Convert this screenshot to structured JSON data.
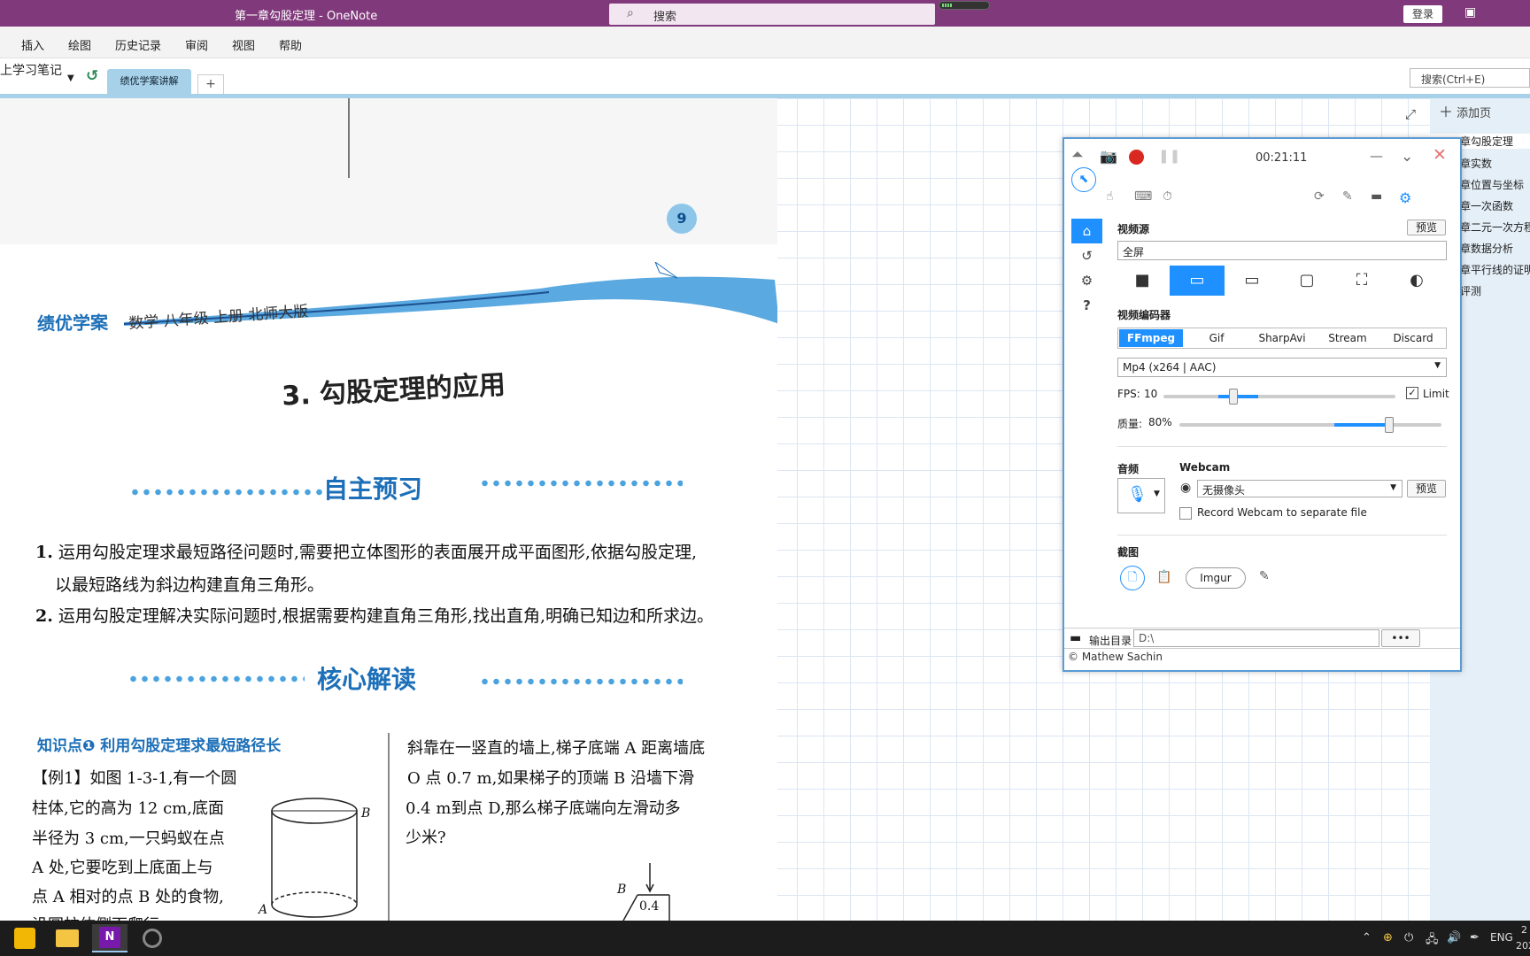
{
  "app": {
    "title": "第一章勾股定理  -  OneNote",
    "search_label": "搜索",
    "login_label": "登录"
  },
  "menu": [
    "插入",
    "绘图",
    "历史记录",
    "审阅",
    "视图",
    "帮助"
  ],
  "notebook": {
    "name": "上学习笔记",
    "section_tab": "绩优学案讲解",
    "add_tab": "+",
    "page_search_placeholder": "搜索(Ctrl+E)"
  },
  "pages": {
    "add_page_label": "添加页",
    "items": [
      "章勾股定理",
      "章实数",
      "章位置与坐标",
      "章一次函数",
      "章二元一次方程",
      "章数据分析",
      "章平行线的证明",
      "评测"
    ],
    "active_index": 0
  },
  "book": {
    "page_number": "9",
    "brand": "绩优学案",
    "brand_sub": "数学 八年级 上册 北师大版",
    "chapter_title": "3. 勾股定理的应用",
    "section1": "自主预习",
    "point1_num": "1.",
    "point1_line1": "运用勾股定理求最短路径问题时,需要把立体图形的表面展开成平面图形,依据勾股定理,",
    "point1_line2": "以最短路线为斜边构建直角三角形。",
    "point2_num": "2.",
    "point2_line1": "运用勾股定理解决实际问题时,根据需要构建直角三角形,找出直角,明确已知边和所求边。",
    "section2": "核心解读",
    "knowledge_point": "知识点❶  利用勾股定理求最短路径长",
    "example_lines": [
      "【例1】如图 1-3-1,有一个圆",
      "柱体,它的高为 12 cm,底面",
      "半径为 3 cm,一只蚂蚁在点",
      "A 处,它要吃到上底面上与",
      "点 A 相对的点 B 处的食物,",
      "沿圆柱体侧面爬行"
    ],
    "right_lines": [
      "斜靠在一竖直的墙上,梯子底端 A 距离墙底",
      "O 点 0.7 m,如果梯子的顶端 B 沿墙下滑",
      "0.4 m到点 D,那么梯子底端向左滑动多",
      "少米?"
    ],
    "fig_label_b": "B",
    "fig_label_a": "A",
    "fig_value": "0.4"
  },
  "recorder": {
    "timer": "00:21:11",
    "video_source_label": "视频源",
    "preview_label": "预览",
    "source_value": "全屏",
    "encoder_label": "视频编码器",
    "encoders": [
      "FFmpeg",
      "Gif",
      "SharpAvi",
      "Stream",
      "Discard"
    ],
    "active_encoder": "FFmpeg",
    "format_value": "Mp4 (x264 | AAC)",
    "fps_label": "FPS:",
    "fps_value": "10",
    "limit_label": "Limit",
    "limit_checked": true,
    "quality_label": "质量:",
    "quality_value": "80%",
    "quality_fraction": 0.8,
    "fps_fraction": 0.3,
    "audio_label": "音频",
    "webcam_label": "Webcam",
    "webcam_value": "无摄像头",
    "webcam_preview": "预览",
    "record_webcam_label": "Record Webcam to separate file",
    "screenshot_label": "截图",
    "imgur_label": "Imgur",
    "output_label": "输出目录",
    "output_path": "D:\\",
    "more_label": "•••",
    "copyright": "© Mathew Sachin",
    "accent_color": "#1e90ff"
  },
  "taskbar": {
    "lang": "ENG",
    "clock_time": "2",
    "clock_date": "202"
  }
}
